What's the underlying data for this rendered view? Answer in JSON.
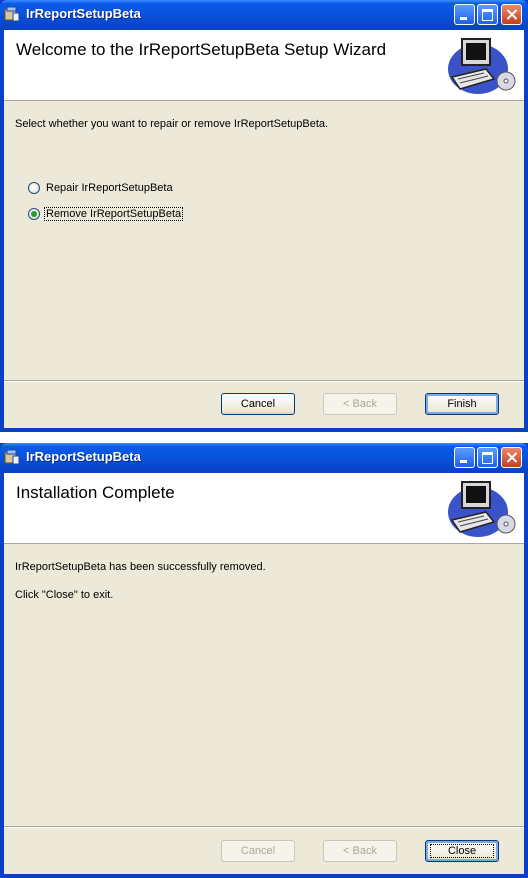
{
  "window1": {
    "title": "IrReportSetupBeta",
    "banner_title": "Welcome to the IrReportSetupBeta Setup Wizard",
    "instruction": "Select whether you want to repair or remove IrReportSetupBeta.",
    "options": [
      {
        "label": "Repair IrReportSetupBeta",
        "checked": false
      },
      {
        "label": "Remove IrReportSetupBeta",
        "checked": true
      }
    ],
    "buttons": {
      "cancel": "Cancel",
      "back": "< Back",
      "finish": "Finish"
    }
  },
  "window2": {
    "title": "IrReportSetupBeta",
    "banner_title": "Installation Complete",
    "message1": "IrReportSetupBeta has been successfully removed.",
    "message2": "Click \"Close\" to exit.",
    "buttons": {
      "cancel": "Cancel",
      "back": "< Back",
      "close": "Close"
    }
  },
  "icons": {
    "app": "installer-icon",
    "banner": "computer-cd-icon"
  },
  "colors": {
    "titlebar": "#0A4FD8",
    "dialog_bg": "#ECE9D8",
    "banner_bg": "#FFFFFF",
    "radio_dot": "#21A121"
  }
}
